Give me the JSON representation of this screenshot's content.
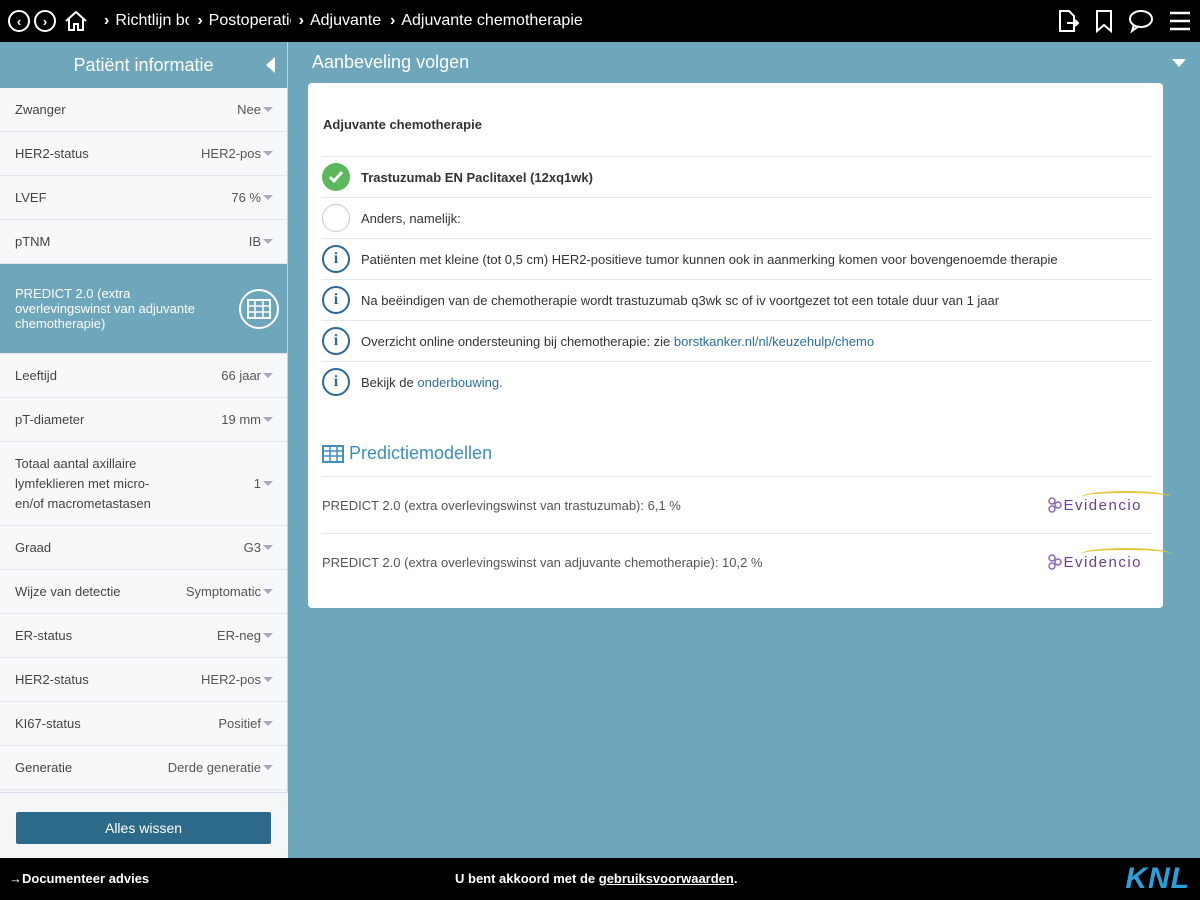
{
  "topbar": {
    "breadcrumbs": [
      "Richtlijn borstkanker",
      "Postoperatief",
      "Adjuvante",
      "Adjuvante chemotherapie"
    ],
    "icons": [
      "back-icon",
      "forward-icon",
      "home-icon",
      "document-export-icon",
      "bookmark-icon",
      "chat-icon",
      "menu-icon"
    ]
  },
  "sidebar": {
    "title": "Patiënt informatie",
    "fields_top": [
      {
        "label": "Zwanger",
        "value": "Nee"
      },
      {
        "label": "HER2-status",
        "value": "HER2-pos"
      },
      {
        "label": "LVEF",
        "value": "76 %"
      },
      {
        "label": "pTNM",
        "value": "IB"
      }
    ],
    "predict_label": "PREDICT 2.0 (extra overlevingswinst van adjuvante chemotherapie)",
    "fields_bottom": [
      {
        "label": "Leeftijd",
        "value": "66 jaar"
      },
      {
        "label": "pT-diameter",
        "value": "19 mm"
      },
      {
        "label": "Totaal aantal axillaire lymfeklieren met micro- en/of macrometastasen",
        "value": "1"
      },
      {
        "label": "Graad",
        "value": "G3"
      },
      {
        "label": "Wijze van detectie",
        "value": "Symptomatic"
      },
      {
        "label": "ER-status",
        "value": "ER-neg"
      },
      {
        "label": "HER2-status",
        "value": "HER2-pos"
      },
      {
        "label": "KI67-status",
        "value": "Positief"
      },
      {
        "label": "Generatie",
        "value": "Derde generatie"
      }
    ],
    "clear_button": "Alles wissen"
  },
  "main": {
    "header": "Aanbeveling volgen",
    "card_title": "Adjuvante chemotherapie",
    "option_selected": "Trastuzumab EN Paclitaxel (12xq1wk)",
    "option_other": "Anders, namelijk:",
    "info1": "Patiënten met kleine (tot 0,5 cm) HER2-positieve tumor kunnen ook in aanmerking komen voor bovengenoemde therapie",
    "info2": "Na beëindigen van de chemotherapie wordt trastuzumab q3wk sc of iv voortgezet tot een totale duur van 1 jaar",
    "info3_prefix": "Overzicht online ondersteuning bij chemotherapie: zie ",
    "info3_link": "borstkanker.nl/nl/keuzehulp/chemo",
    "info4_prefix": "Bekijk de ",
    "info4_link": "onderbouwing",
    "info4_suffix": ".",
    "predictions_title": "Predictiemodellen",
    "predictions": [
      {
        "text": "PREDICT 2.0 (extra overlevingswinst van trastuzumab): 6,1 %",
        "brand": "Evidencio"
      },
      {
        "text": "PREDICT 2.0 (extra overlevingswinst van adjuvante chemotherapie): 10,2 %",
        "brand": "Evidencio"
      }
    ]
  },
  "bottombar": {
    "document_link": "Documenteer advies",
    "agree_prefix": "U bent akkoord met de ",
    "agree_link": "gebruiksvoorwaarden",
    "agree_suffix": ".",
    "logo": "KNL"
  },
  "colors": {
    "accent": "#6ea7bb",
    "button": "#2d6a89",
    "check": "#5cb85c",
    "link": "#2a6fa8"
  }
}
